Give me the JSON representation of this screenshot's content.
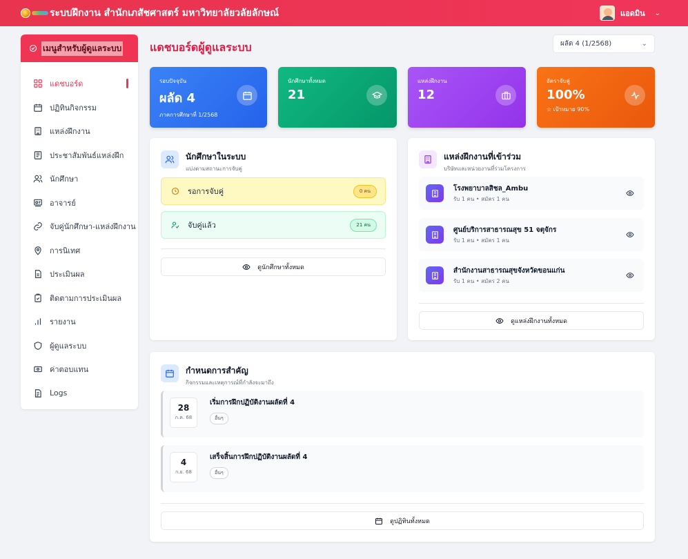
{
  "app": {
    "title": "ระบบฝึกงาน สำนักเภสัชศาสตร์ มหาวิทยาลัยวลัยลักษณ์",
    "user_name": "แอดมิน"
  },
  "sidebar": {
    "header": "เมนูสำหรับผู้ดูแลระบบ",
    "items": [
      {
        "label": "แดชบอร์ด",
        "icon": "dashboard-icon",
        "active": true
      },
      {
        "label": "ปฏิทินกิจกรรม",
        "icon": "calendar-icon"
      },
      {
        "label": "แหล่งฝึกงาน",
        "icon": "building-icon"
      },
      {
        "label": "ประชาสัมพันธ์แหล่งฝึก",
        "icon": "newspaper-icon"
      },
      {
        "label": "นักศึกษา",
        "icon": "users-icon"
      },
      {
        "label": "อาจารย์",
        "icon": "teacher-icon"
      },
      {
        "label": "จับคู่นักศึกษา-แหล่งฝึกงาน",
        "icon": "link-icon"
      },
      {
        "label": "การนิเทศ",
        "icon": "location-icon"
      },
      {
        "label": "ประเมินผล",
        "icon": "file-icon"
      },
      {
        "label": "ติดตามการประเมินผล",
        "icon": "clipboard-check-icon"
      },
      {
        "label": "รายงาน",
        "icon": "bar-chart-icon"
      },
      {
        "label": "ผู้ดูแลระบบ",
        "icon": "shield-icon"
      },
      {
        "label": "ค่าตอบแทน",
        "icon": "banknote-icon"
      },
      {
        "label": "Logs",
        "icon": "file-text-icon"
      }
    ]
  },
  "main": {
    "title": "แดชบอร์ดผู้ดูแลระบบ",
    "term_select": "ผลัด 4 (1/2568)",
    "stats": {
      "current": {
        "label": "รอบปัจจุบัน",
        "value": "ผลัด 4",
        "sub": "ภาคการศึกษาที่ 1/2568"
      },
      "students": {
        "label": "นักศึกษาทั้งหมด",
        "value": "21"
      },
      "places": {
        "label": "แหล่งฝึกงาน",
        "value": "12"
      },
      "match": {
        "label": "อัตราจับคู่",
        "value": "100%",
        "sub": "☆ เป้าหมาย 90%"
      }
    },
    "students_card": {
      "title": "นักศึกษาในระบบ",
      "subtitle": "แบ่งตามสถานะการจับคู่",
      "pending": {
        "label": "รอการจับคู่",
        "count": "0 คน"
      },
      "matched": {
        "label": "จับคู่แล้ว",
        "count": "21 คน"
      },
      "button": "ดูนักศึกษาทั้งหมด"
    },
    "places_card": {
      "title": "แหล่งฝึกงานที่เข้าร่วม",
      "subtitle": "บริษัทและหน่วยงานที่ร่วมโครงการ",
      "items": [
        {
          "name": "โรงพยาบาลสิชล_Ambu",
          "meta": "รับ 1 คน • สมัคร 1 คน"
        },
        {
          "name": "ศูนย์บริการสาธารณสุข 51 จตุจักร",
          "meta": "รับ 1 คน • สมัคร 1 คน"
        },
        {
          "name": "สำนักงานสาธารณสุขจังหวัดขอนแก่น",
          "meta": "รับ 1 คน • สมัคร 2 คน"
        }
      ],
      "button": "ดูแหล่งฝึกงานทั้งหมด"
    },
    "events_card": {
      "title": "กำหนดการสำคัญ",
      "subtitle": "กิจกรรมและเหตุการณ์ที่กำลังจะมาถึง",
      "items": [
        {
          "day": "28",
          "month": "ก.ค. 68",
          "title": "เริ่มการฝึกปฏิบัติงานผลัดที่ 4",
          "tag": "อื่นๆ"
        },
        {
          "day": "4",
          "month": "ก.ย. 68",
          "title": "เสร็จสิ้นการฝึกปฏิบัติงานผลัดที่ 4",
          "tag": "อื่นๆ"
        }
      ],
      "button": "ดูปฏิทินทั้งหมด"
    }
  }
}
